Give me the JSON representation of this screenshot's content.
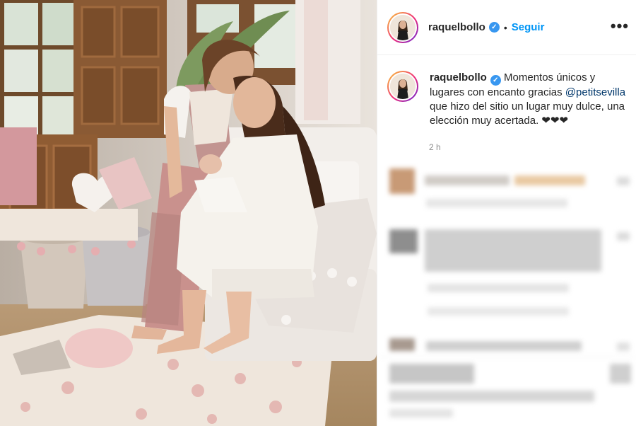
{
  "post": {
    "username": "raquelbollo",
    "verified_badge": "✓",
    "separator": "•",
    "follow_label": "Seguir",
    "more_icon": "•••",
    "caption": {
      "text_before_mention": "Momentos únicos y lugares con encanto gracias ",
      "mention": "@petitsevilla",
      "text_after_mention": " que hizo del sitio un lugar muy dulce, una elección muy acertada. ❤❤❤"
    },
    "time": "2 h"
  },
  "colors": {
    "accent": "#0095f6",
    "verified": "#3897f0",
    "mention": "#00376b",
    "muted": "#8e8e8e"
  },
  "icons": {
    "verified": "verified-badge-icon",
    "more": "more-options-icon"
  }
}
